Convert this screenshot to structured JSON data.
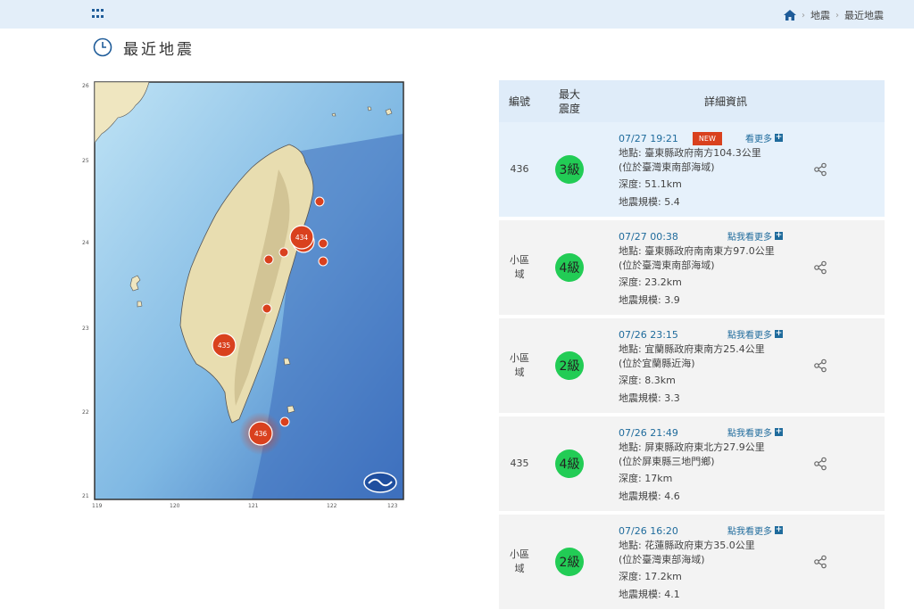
{
  "header": {
    "breadcrumb": [
      "地震",
      "最近地震"
    ]
  },
  "page": {
    "title": "最近地震"
  },
  "map": {
    "lat_ticks": [
      "26",
      "25",
      "24",
      "23",
      "22",
      "21"
    ],
    "lon_ticks": [
      "119",
      "120",
      "121",
      "122",
      "123"
    ],
    "markers": [
      {
        "label": "434"
      },
      {
        "label": "435"
      },
      {
        "label": "436"
      }
    ]
  },
  "table": {
    "headers": {
      "id": "編號",
      "intensity": "最大\n震度",
      "info": "詳細資訊"
    },
    "rows": [
      {
        "id": "436",
        "intensity": "3級",
        "time": "07/27 19:21",
        "new": "NEW",
        "more": "看更多",
        "location": "地點: 臺東縣政府南方104.3公里",
        "region": "(位於臺灣東南部海域)",
        "depth": "深度: 51.1km",
        "magnitude": "地震規模: 5.4"
      },
      {
        "id": "小區域",
        "intensity": "4級",
        "time": "07/27 00:38",
        "more": "點我看更多",
        "location": "地點: 臺東縣政府南南東方97.0公里",
        "region": "(位於臺灣東南部海域)",
        "depth": "深度: 23.2km",
        "magnitude": "地震規模: 3.9"
      },
      {
        "id": "小區域",
        "intensity": "2級",
        "time": "07/26 23:15",
        "more": "點我看更多",
        "location": "地點: 宜蘭縣政府東南方25.4公里",
        "region": "(位於宜蘭縣近海)",
        "depth": "深度: 8.3km",
        "magnitude": "地震規模: 3.3"
      },
      {
        "id": "435",
        "intensity": "4級",
        "time": "07/26 21:49",
        "more": "點我看更多",
        "location": "地點: 屏東縣政府東北方27.9公里",
        "region": "(位於屏東縣三地門鄉)",
        "depth": "深度: 17km",
        "magnitude": "地震規模: 4.6"
      },
      {
        "id": "小區域",
        "intensity": "2級",
        "time": "07/26 16:20",
        "more": "點我看更多",
        "location": "地點: 花蓮縣政府東方35.0公里",
        "region": "(位於臺灣東部海域)",
        "depth": "深度: 17.2km",
        "magnitude": "地震規模: 4.1"
      }
    ]
  },
  "colors": {
    "topbar": "#e3eef9",
    "accent": "#1f6b9c",
    "intensity_green": "#22cc55",
    "marker_red": "#d9411e",
    "new_badge": "#d9411e"
  }
}
